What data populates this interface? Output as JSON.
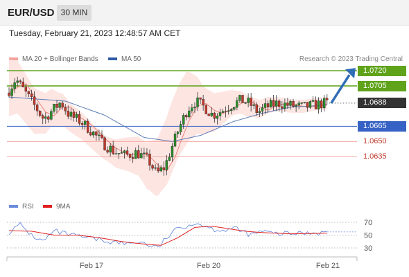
{
  "header": {
    "symbol": "EUR/USD",
    "timeframe": "30 MIN"
  },
  "timestamp": "Tuesday, February 21, 2023 12:48:57 AM CET",
  "legend": {
    "ma20": "MA 20 + Bollinger Bands",
    "ma50": "MA 50",
    "copyright": "Research © 2023 Trading Central"
  },
  "colors": {
    "up": "#2a8f2a",
    "down": "#c0392b",
    "bands_fill": "#fde0dd",
    "ma20": "#e8837a",
    "ma50": "#5b7bb5",
    "resistance": "#5fa31a",
    "support_strong": "#3562c4",
    "support_weak": "#f4aaa3",
    "current": "#333333",
    "arrow": "#2f6db5",
    "rsi": "#6b8cdc",
    "rsi_ma": "#e02020"
  },
  "levels": [
    {
      "value": 1.072,
      "label": "1.0720",
      "kind": "resistance"
    },
    {
      "value": 1.0705,
      "label": "1.0705",
      "kind": "resistance"
    },
    {
      "value": 1.0688,
      "label": "1.0688",
      "kind": "current"
    },
    {
      "value": 1.0665,
      "label": "1.0665",
      "kind": "support_strong"
    },
    {
      "value": 1.065,
      "label": "1.0650",
      "kind": "support_weak"
    },
    {
      "value": 1.0635,
      "label": "1.0635",
      "kind": "support_weak"
    }
  ],
  "rsi_panel": {
    "rsi_label": "RSI",
    "ma_label": "9MA",
    "ticks": [
      "70",
      "50",
      "30"
    ],
    "tick_values": [
      70,
      50,
      30
    ]
  },
  "x_axis": {
    "ticks": [
      "Feb 17",
      "Feb 20",
      "Feb 21"
    ]
  },
  "chart_data": {
    "type": "candlestick",
    "title": "EUR/USD",
    "timeframe": "30 MIN",
    "ylim": [
      1.0594,
      1.0727
    ],
    "price_path": [
      [
        0,
        1.0698
      ],
      [
        3,
        1.0712
      ],
      [
        6,
        1.07
      ],
      [
        10,
        1.0684
      ],
      [
        13,
        1.0672
      ],
      [
        16,
        1.0681
      ],
      [
        19,
        1.0689
      ],
      [
        22,
        1.0676
      ],
      [
        26,
        1.067
      ],
      [
        30,
        1.066
      ],
      [
        34,
        1.0648
      ],
      [
        38,
        1.064
      ],
      [
        42,
        1.0636
      ],
      [
        46,
        1.0639
      ],
      [
        50,
        1.0632
      ],
      [
        53,
        1.0618
      ],
      [
        56,
        1.0625
      ],
      [
        58,
        1.0641
      ],
      [
        61,
        1.0663
      ],
      [
        64,
        1.0682
      ],
      [
        67,
        1.069
      ],
      [
        70,
        1.0684
      ],
      [
        73,
        1.0676
      ],
      [
        76,
        1.068
      ],
      [
        79,
        1.0685
      ],
      [
        83,
        1.0691
      ],
      [
        86,
        1.0688
      ],
      [
        89,
        1.0679
      ],
      [
        92,
        1.0684
      ],
      [
        96,
        1.0688
      ],
      [
        100,
        1.0686
      ],
      [
        105,
        1.0684
      ],
      [
        109,
        1.0686
      ],
      [
        113,
        1.0688
      ]
    ],
    "bollinger_width": [
      [
        0,
        0.0028
      ],
      [
        10,
        0.0022
      ],
      [
        22,
        0.0014
      ],
      [
        35,
        0.0012
      ],
      [
        47,
        0.002
      ],
      [
        57,
        0.0035
      ],
      [
        63,
        0.0036
      ],
      [
        70,
        0.0022
      ],
      [
        80,
        0.0012
      ],
      [
        95,
        0.0007
      ],
      [
        113,
        0.0006
      ]
    ],
    "ma50_path": [
      [
        0,
        1.0694
      ],
      [
        20,
        1.069
      ],
      [
        34,
        1.0676
      ],
      [
        48,
        1.0654
      ],
      [
        58,
        1.065
      ],
      [
        68,
        1.0656
      ],
      [
        80,
        1.067
      ],
      [
        90,
        1.0678
      ],
      [
        100,
        1.0684
      ],
      [
        113,
        1.0686
      ]
    ],
    "rsi_path": [
      [
        0,
        55
      ],
      [
        4,
        66
      ],
      [
        8,
        50
      ],
      [
        12,
        40
      ],
      [
        16,
        56
      ],
      [
        20,
        52
      ],
      [
        24,
        48
      ],
      [
        30,
        44
      ],
      [
        36,
        40
      ],
      [
        42,
        36
      ],
      [
        46,
        40
      ],
      [
        50,
        34
      ],
      [
        53,
        30
      ],
      [
        56,
        46
      ],
      [
        60,
        60
      ],
      [
        64,
        67
      ],
      [
        68,
        68
      ],
      [
        72,
        60
      ],
      [
        76,
        58
      ],
      [
        80,
        60
      ],
      [
        84,
        54
      ],
      [
        86,
        50
      ],
      [
        90,
        56
      ],
      [
        94,
        52
      ],
      [
        100,
        52
      ],
      [
        106,
        54
      ],
      [
        113,
        54
      ]
    ],
    "rsi_ma_path": [
      [
        0,
        57
      ],
      [
        8,
        56
      ],
      [
        16,
        50
      ],
      [
        24,
        50
      ],
      [
        32,
        46
      ],
      [
        40,
        40
      ],
      [
        48,
        36
      ],
      [
        54,
        34
      ],
      [
        60,
        46
      ],
      [
        66,
        62
      ],
      [
        72,
        64
      ],
      [
        78,
        60
      ],
      [
        84,
        56
      ],
      [
        90,
        54
      ],
      [
        100,
        52
      ],
      [
        113,
        53
      ]
    ],
    "forecast": {
      "from": 1.0688,
      "to": 1.072
    },
    "candle_count": 114
  }
}
